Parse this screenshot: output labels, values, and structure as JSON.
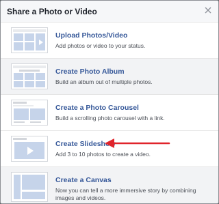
{
  "dialog": {
    "title": "Share a Photo or Video",
    "close_icon": "close-icon"
  },
  "options": [
    {
      "title": "Upload Photos/Video",
      "description": "Add photos or video to your status.",
      "thumb": "upload-thumbnail-icon"
    },
    {
      "title": "Create Photo Album",
      "description": "Build an album out of multiple photos.",
      "thumb": "album-thumbnail-icon"
    },
    {
      "title": "Create a Photo Carousel",
      "description": "Build a scrolling photo carousel with a link.",
      "thumb": "carousel-thumbnail-icon"
    },
    {
      "title": "Create Slideshow",
      "description": "Add 3 to 10 photos to create a video.",
      "thumb": "slideshow-thumbnail-icon"
    },
    {
      "title": "Create a Canvas",
      "description": "Now you can tell a more immersive story by combining images and videos.",
      "thumb": "canvas-thumbnail-icon"
    }
  ],
  "annotation": {
    "color": "#e0242b",
    "target": "Create Slideshow"
  },
  "colors": {
    "link": "#365899",
    "header_bg": "#f6f7f9",
    "thumb_fill": "#c6d4ea"
  }
}
